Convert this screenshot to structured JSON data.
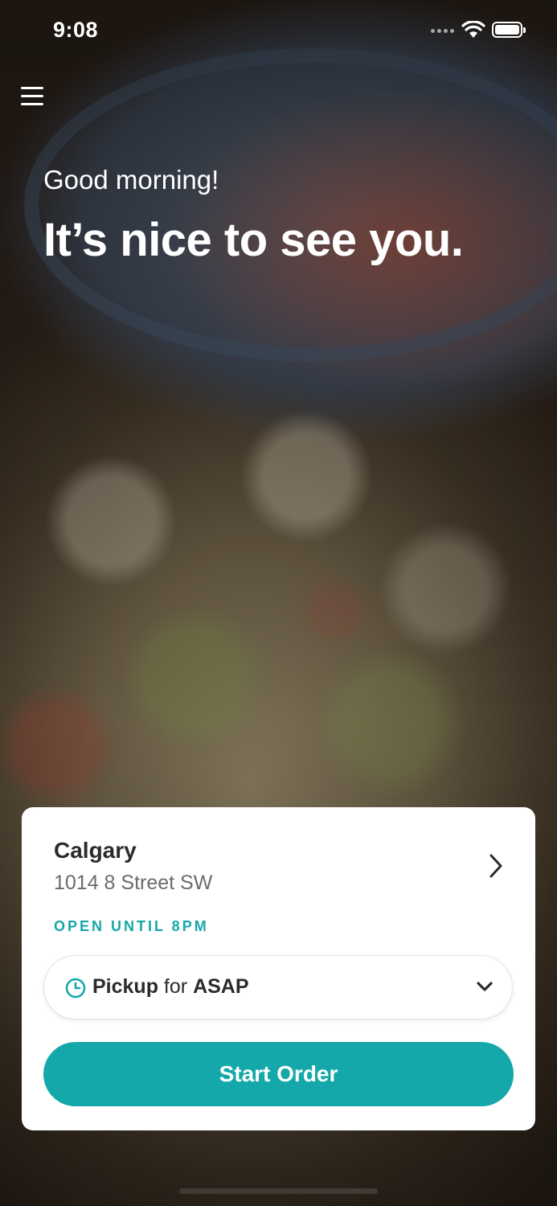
{
  "status_bar": {
    "time": "9:08"
  },
  "header": {
    "greeting": "Good morning!",
    "headline": "It’s nice to see you."
  },
  "location_card": {
    "name": "Calgary",
    "address": "1014 8 Street SW",
    "hours": "OPEN UNTIL 8PM",
    "pickup": {
      "mode": "Pickup",
      "connector": " for ",
      "time": "ASAP"
    },
    "start_button_label": "Start Order"
  },
  "icons": {
    "menu": "hamburger-menu-icon",
    "location_chevron": "chevron-right-icon",
    "pickup_clock": "clock-icon",
    "pickup_dropdown": "chevron-down-icon"
  },
  "colors": {
    "accent": "#14a8aa",
    "hours_text": "#17a7a8"
  }
}
